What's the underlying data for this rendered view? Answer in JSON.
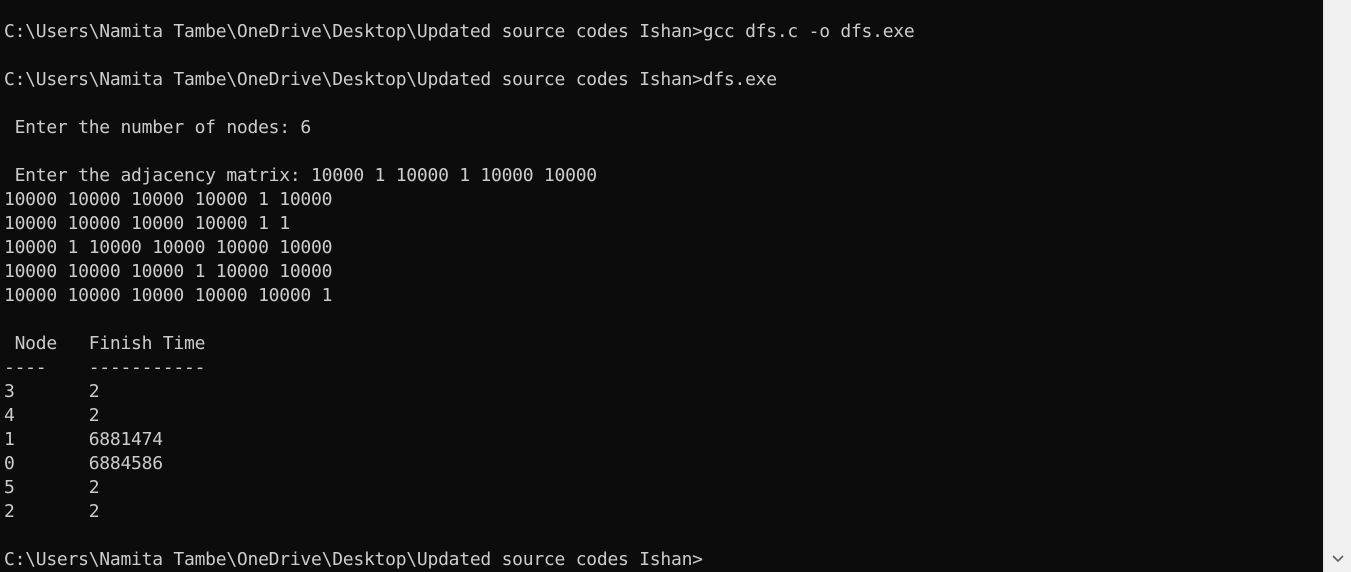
{
  "console": {
    "lines": [
      "C:\\Users\\Namita Tambe\\OneDrive\\Desktop\\Updated source codes Ishan>gcc dfs.c -o dfs.exe",
      "",
      "C:\\Users\\Namita Tambe\\OneDrive\\Desktop\\Updated source codes Ishan>dfs.exe",
      "",
      " Enter the number of nodes: 6",
      "",
      " Enter the adjacency matrix: 10000 1 10000 1 10000 10000",
      "10000 10000 10000 10000 1 10000",
      "10000 10000 10000 10000 1 1",
      "10000 1 10000 10000 10000 10000",
      "10000 10000 10000 1 10000 10000",
      "10000 10000 10000 10000 10000 1",
      "",
      " Node   Finish Time",
      "----    -----------",
      "3       2",
      "4       2",
      "1       6881474",
      "0       6884586",
      "5       2",
      "2       2",
      "",
      "C:\\Users\\Namita Tambe\\OneDrive\\Desktop\\Updated source codes Ishan>"
    ]
  },
  "scrollbar": {
    "down_icon": "chevron-down-icon"
  },
  "colors": {
    "background": "#0c0c0c",
    "text": "#cccccc",
    "scrollbar": "#f0f0f0",
    "arrow": "#606060"
  }
}
